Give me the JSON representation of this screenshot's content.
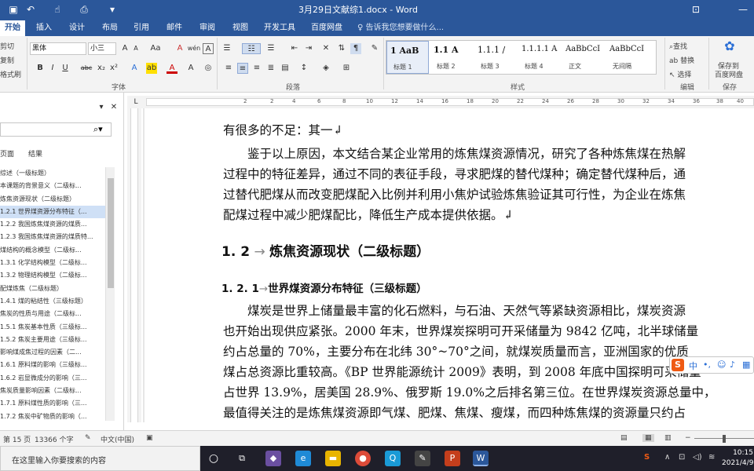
{
  "titlebar": {
    "title": "3月29日文献综1.docx - Word",
    "quick_access": [
      "save-icon",
      "undo-icon",
      "redo-icon",
      "touch-mode-icon",
      "print-preview-icon",
      "customize-icon"
    ],
    "window_controls": [
      "ribbon-display-icon",
      "minimize-icon"
    ]
  },
  "tabs": {
    "items": [
      "开始",
      "插入",
      "设计",
      "布局",
      "引用",
      "邮件",
      "审阅",
      "视图",
      "开发工具",
      "百度网盘"
    ],
    "active": "开始",
    "tell_me": "告诉我您想要做什么..."
  },
  "ribbon": {
    "clipboard": {
      "cut": "剪切",
      "copy": "复制",
      "format_painter": "格式刷"
    },
    "font": {
      "group_label": "字体",
      "font_name": "黑体",
      "font_size": "小三",
      "grow": "A",
      "shrink": "A",
      "case": "Aa",
      "clear": "A",
      "phonetic": "wén",
      "border_char": "A",
      "bold": "B",
      "italic": "I",
      "underline": "U",
      "strike": "abc",
      "sub": "x₂",
      "sup": "x²"
    },
    "paragraph": {
      "group_label": "段落"
    },
    "styles": {
      "group_label": "样式",
      "items": [
        {
          "sample": "1  AaB",
          "name": "标题 1"
        },
        {
          "sample": "1.1  A",
          "name": "标题 2"
        },
        {
          "sample": "1.1.1  /",
          "name": "标题 3"
        },
        {
          "sample": "1.1.1.1 A",
          "name": "标题 4"
        },
        {
          "sample": "AaBbCcI",
          "name": "正文"
        },
        {
          "sample": "AaBbCcI",
          "name": "无间隔"
        }
      ]
    },
    "editing": {
      "group_label": "编辑",
      "find": "查找",
      "replace": "替换",
      "select": "选择"
    },
    "save": {
      "group_label": "保存",
      "label_line1": "保存到",
      "label_line2": "百度网盘"
    }
  },
  "nav": {
    "tabs": [
      "页面",
      "结果"
    ],
    "items": [
      "综述（一级标题）",
      "本课题的背景意义（二级标...",
      "炼焦资源现状（二级标题）",
      "1.2.1 世界煤资源分布特征（...",
      "1.2.2 我国炼焦煤资源的煤质...",
      "1.2.3 我国炼焦煤资源的煤质特...",
      "煤结构的概念模型（二级标...",
      "1.3.1 化学结构模型（二级标...",
      "1.3.2 物理结构模型（二级标...",
      "配煤炼焦（二级标题）",
      "1.4.1 煤的粘结性（三级标题）",
      "焦炭的性质与用途（二级标...",
      "1.5.1 焦炭基本性质（三级标...",
      "1.5.2 焦炭主要用途（三级标...",
      "影响煤成焦过程的因素（二...",
      "1.6.1 原料煤的影响（三级标...",
      "1.6.2 岩显微成分的影响（三...",
      "焦炭质量影响因素（二级标...",
      "1.7.1 原料煤性质的影响（三...",
      "1.7.2 焦炭中矿物质的影响（..."
    ],
    "active_index": 3
  },
  "ruler": {
    "numbers": [
      "2",
      "2",
      "4",
      "6",
      "8",
      "10",
      "12",
      "14",
      "16",
      "18",
      "20",
      "22",
      "24",
      "26",
      "28",
      "30",
      "32",
      "34",
      "36",
      "38",
      "40"
    ]
  },
  "document": {
    "lines": [
      "有很多的不足：其一↲",
      "　　鉴于以上原因，本文结合某企业常用的炼焦煤资源情况，研究了各种炼焦煤在热解",
      "过程中的特征差异，通过不同的表征手段，寻求肥煤的替代煤种；确定替代煤种后，通",
      "过替代肥煤从而改变肥煤配入比例并利用小焦炉试验炼焦验证其可行性，为企业在炼焦",
      "配煤过程中减少肥煤配比，降低生产成本提供依据。↲"
    ],
    "heading2": {
      "num": "1. 2",
      "text": "炼焦资源现状（二级标题）"
    },
    "heading3": {
      "num": "1. 2. 1",
      "text": "世界煤资源分布特征（三级标题）"
    },
    "lines2": [
      "　　煤炭是世界上储量最丰富的化石燃料，与石油、天然气等紧缺资源相比，煤炭资源",
      "也开始出现供应紧张。2000 年末，世界煤炭探明可开采储量为 9842 亿吨，北半球储量",
      "约占总量的 70%，主要分布在北纬 30°~70°之间，就煤炭质量而言，亚洲国家的优质",
      "煤占总资源比重较高。《BP 世界能源统计 2009》表明，到 2008 年底中国探明可采储量",
      "占世界 13.9%，居美国 28.9%、俄罗斯 19.0%之后排名第三位。在世界煤炭资源总量中，",
      "最值得关注的是炼焦煤资源即气煤、肥煤、焦煤、瘦煤，而四种炼焦煤的资源量只约占"
    ]
  },
  "ime": {
    "logo": "S",
    "mode": "中"
  },
  "status": {
    "page": "第 15 页",
    "words": "13366 个字",
    "lang": "中文(中国)"
  },
  "taskbar": {
    "search_placeholder": "在这里输入你要搜索的内容",
    "time": "10:15",
    "date": "2021/4/9"
  }
}
